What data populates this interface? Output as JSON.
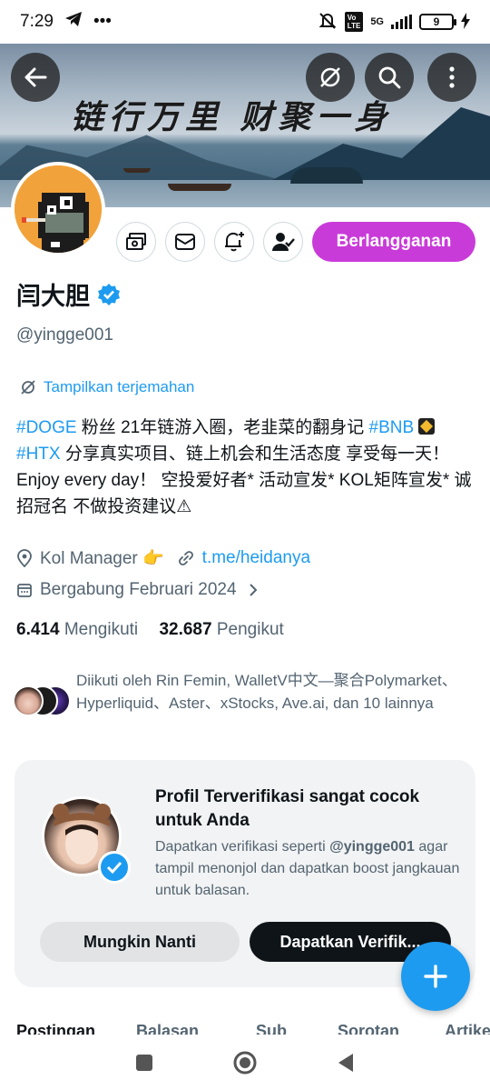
{
  "status_bar": {
    "time": "7:29",
    "dots": "•••",
    "battery": "9",
    "network": "5G"
  },
  "banner": {
    "calligraphy": "链行万里  财聚一身"
  },
  "profile": {
    "name": "闫大胆",
    "handle": "@yingge001",
    "translate_label": "Tampilkan terjemahan",
    "subscribe_label": "Berlangganan",
    "bio": {
      "tag_doge": "#DOGE",
      "part1": " 粉丝 21年链游入圈，老韭菜的翻身记 ",
      "tag_bnb": "#BNB",
      "tag_htx": "#HTX",
      "part2": " 分享真实项目、链上机会和生活态度  享受每一天！ Enjoy every day！ 空投爱好者*  活动宣发*  KOL矩阵宣发*  诚招冠名 不做投资建议⚠"
    },
    "job": "Kol Manager 👉",
    "link": "t.me/heidanya",
    "joined": "Bergabung Februari 2024",
    "following_count": "6.414",
    "following_label": "Mengikuti",
    "followers_count": "32.687",
    "followers_label": "Pengikut",
    "followed_by": "Diikuti oleh Rin Femin, WalletV中文—聚合Polymarket、Hyperliquid、Aster、xStocks, Ave.ai, dan 10 lainnya"
  },
  "verify_card": {
    "title": "Profil Terverifikasi sangat cocok untuk Anda",
    "desc_before": "Dapatkan verifikasi seperti ",
    "desc_handle": "@yingge001",
    "desc_after": " agar tampil menonjol dan dapatkan boost jangkauan untuk balasan.",
    "later_label": "Mungkin Nanti",
    "get_label": "Dapatkan Verifik..."
  },
  "tabs": [
    "Postingan",
    "Balasan",
    "Sub",
    "Sorotan",
    "Artikel"
  ],
  "colors": {
    "accent": "#1d9bf0",
    "subscribe": "#c93bd9",
    "text": "#0f1419",
    "muted": "#536471"
  }
}
